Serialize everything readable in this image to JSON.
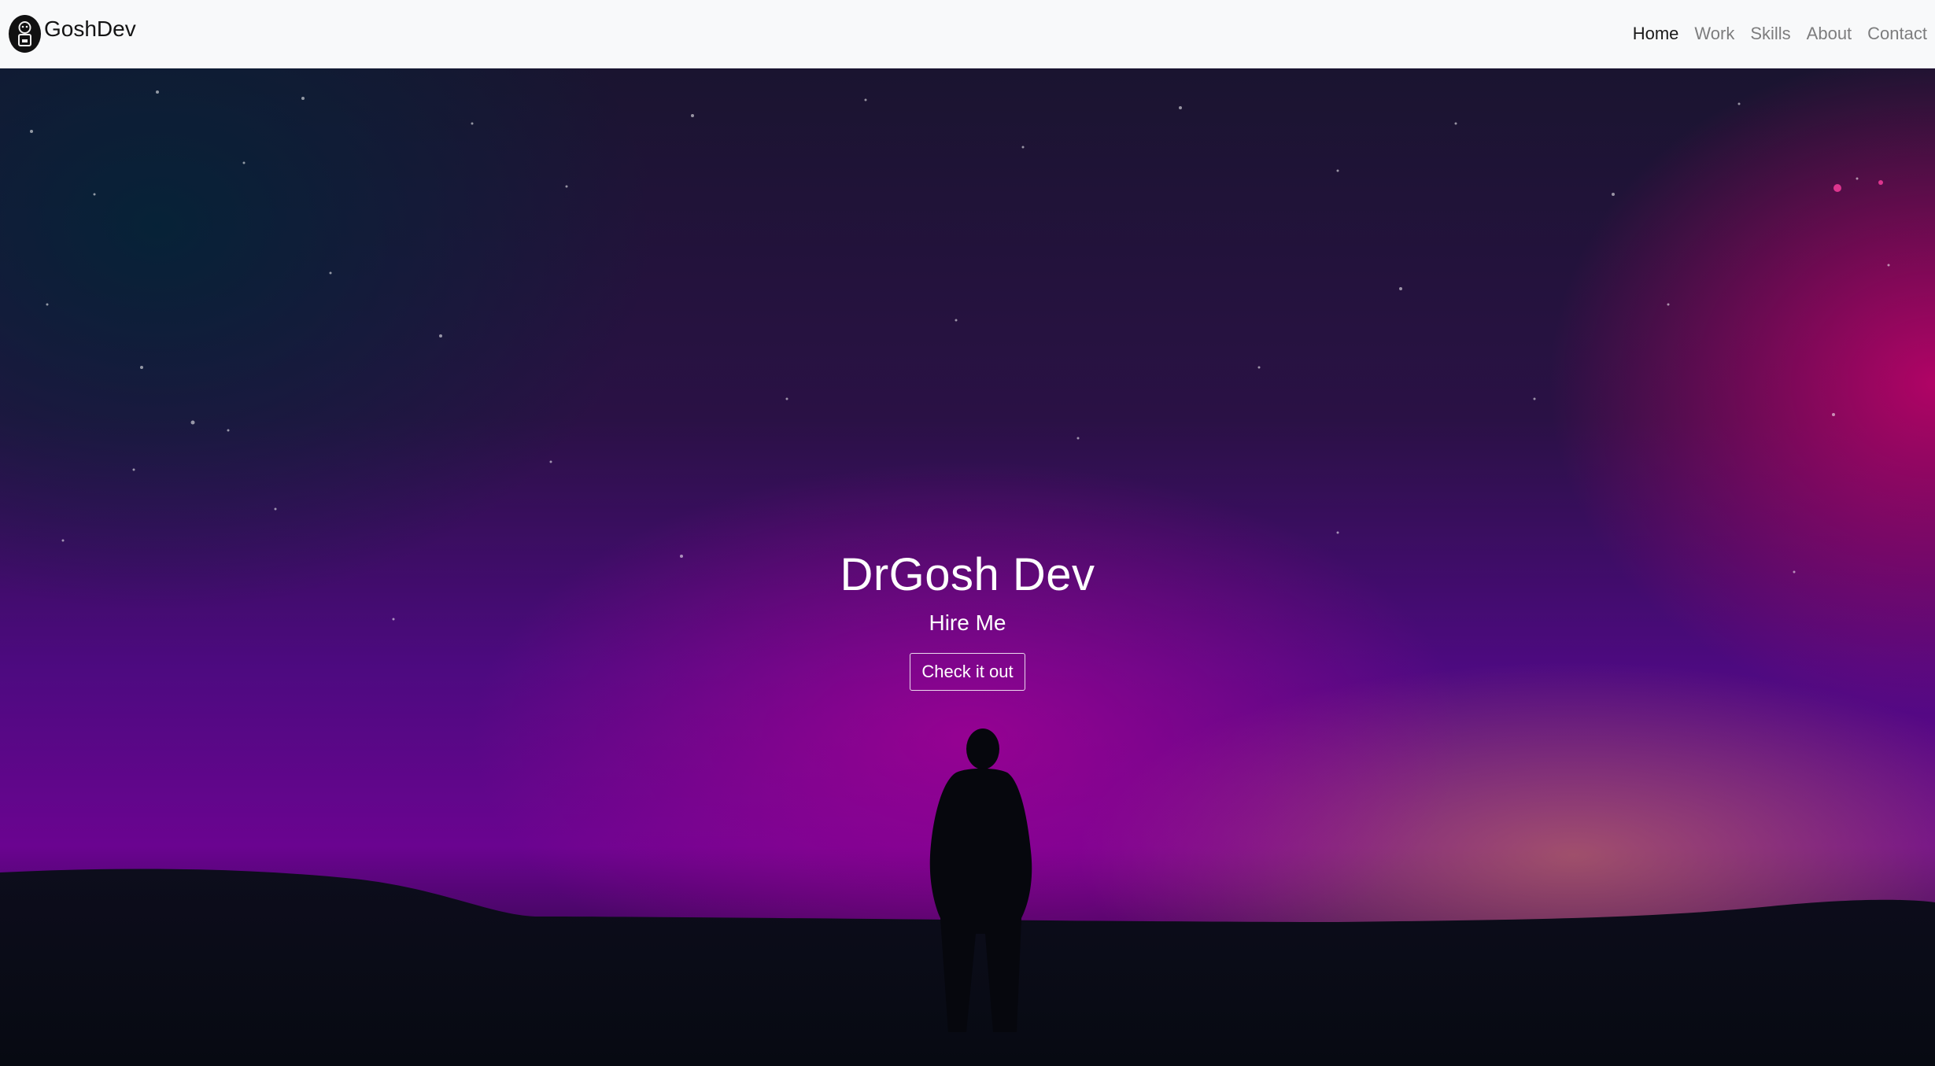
{
  "brand": {
    "name": "GoshDev",
    "logo_icon": "robot-avatar-icon"
  },
  "nav": {
    "items": [
      {
        "label": "Home",
        "active": true
      },
      {
        "label": "Work",
        "active": false
      },
      {
        "label": "Skills",
        "active": false
      },
      {
        "label": "About",
        "active": false
      },
      {
        "label": "Contact",
        "active": false
      }
    ]
  },
  "hero": {
    "title": "DrGosh Dev",
    "subtitle": "Hire Me",
    "button_label": "Check it out"
  },
  "colors": {
    "navbar_bg": "#f8f9fa",
    "sky_top": "#1a1430",
    "sky_purple": "#4d0a80",
    "sky_magenta": "#c8007a",
    "ground": "#0a0c16"
  }
}
